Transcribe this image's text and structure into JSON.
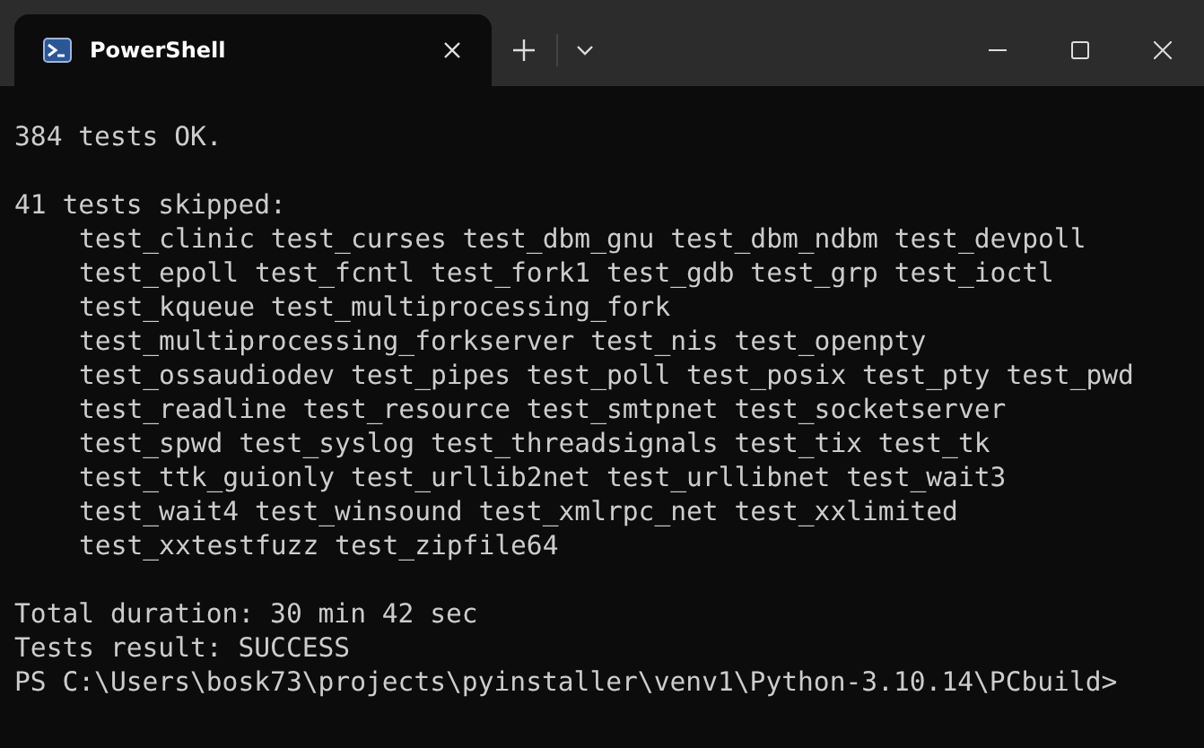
{
  "tabs": [
    {
      "title": "PowerShell",
      "selected": true
    }
  ],
  "terminal": {
    "lines": [
      {
        "kind": "blank"
      },
      {
        "kind": "text",
        "text": "384 tests OK."
      },
      {
        "kind": "blank"
      },
      {
        "kind": "text",
        "text": "41 tests skipped:"
      },
      {
        "kind": "indented",
        "text": "test_clinic test_curses test_dbm_gnu test_dbm_ndbm test_devpoll"
      },
      {
        "kind": "indented",
        "text": "test_epoll test_fcntl test_fork1 test_gdb test_grp test_ioctl"
      },
      {
        "kind": "indented",
        "text": "test_kqueue test_multiprocessing_fork"
      },
      {
        "kind": "indented",
        "text": "test_multiprocessing_forkserver test_nis test_openpty"
      },
      {
        "kind": "indented",
        "text": "test_ossaudiodev test_pipes test_poll test_posix test_pty test_pwd"
      },
      {
        "kind": "indented",
        "text": "test_readline test_resource test_smtpnet test_socketserver"
      },
      {
        "kind": "indented",
        "text": "test_spwd test_syslog test_threadsignals test_tix test_tk"
      },
      {
        "kind": "indented",
        "text": "test_ttk_guionly test_urllib2net test_urllibnet test_wait3"
      },
      {
        "kind": "indented",
        "text": "test_wait4 test_winsound test_xmlrpc_net test_xxlimited"
      },
      {
        "kind": "indented",
        "text": "test_xxtestfuzz test_zipfile64"
      },
      {
        "kind": "blank"
      },
      {
        "kind": "text",
        "text": "Total duration: 30 min 42 sec"
      },
      {
        "kind": "text",
        "text": "Tests result: SUCCESS"
      },
      {
        "kind": "text",
        "text": "PS C:\\Users\\bosk73\\projects\\pyinstaller\\venv1\\Python-3.10.14\\PCbuild>"
      }
    ]
  }
}
